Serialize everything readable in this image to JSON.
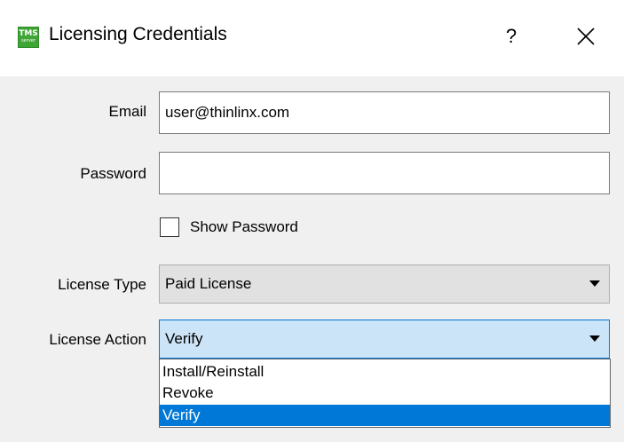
{
  "window": {
    "title": "Licensing Credentials",
    "icon_text": "TMS",
    "icon_subtext": "server",
    "help_label": "?"
  },
  "form": {
    "email_label": "Email",
    "email_value": "user@thinlinx.com",
    "password_label": "Password",
    "password_value": "",
    "show_password_label": "Show Password",
    "show_password_checked": false,
    "license_type_label": "License Type",
    "license_type_value": "Paid License",
    "license_action_label": "License Action",
    "license_action_value": "Verify"
  },
  "license_action_options": [
    {
      "label": "Install/Reinstall",
      "selected": false
    },
    {
      "label": "Revoke",
      "selected": false
    },
    {
      "label": "Verify",
      "selected": true
    }
  ],
  "colors": {
    "selection": "#0078d7",
    "focus_bg": "#cce4f7",
    "icon_green": "#3fa535"
  }
}
